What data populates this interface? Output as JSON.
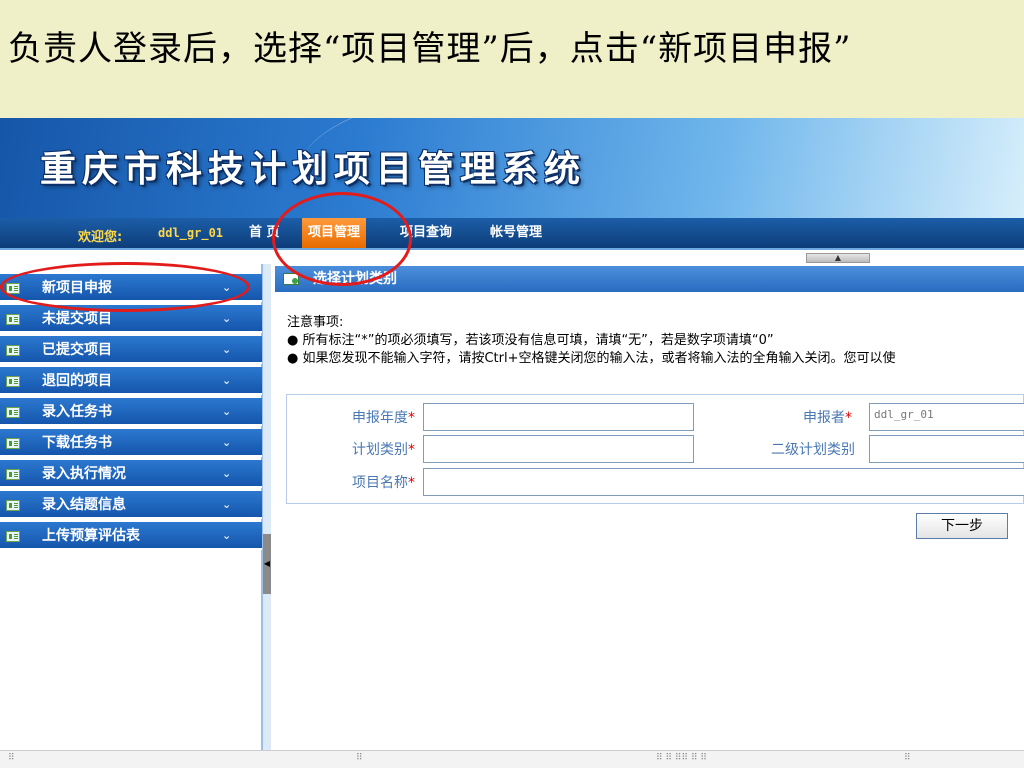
{
  "slide": {
    "title": "负责人登录后，选择“项目管理”后，点击“新项目申报”"
  },
  "app": {
    "banner_title": "重庆市科技计划项目管理系统",
    "welcome_label": "欢迎您:",
    "username": "ddl_gr_01",
    "nav": [
      "首 页",
      "项目管理",
      "项目查询",
      "帐号管理"
    ],
    "active_nav": "项目管理"
  },
  "sidebar": {
    "items": [
      {
        "label": "新项目申报"
      },
      {
        "label": "未提交项目"
      },
      {
        "label": "已提交项目"
      },
      {
        "label": "退回的项目"
      },
      {
        "label": "录入任务书"
      },
      {
        "label": "下载任务书"
      },
      {
        "label": "录入执行情况"
      },
      {
        "label": "录入结题信息"
      },
      {
        "label": "上传预算评估表"
      }
    ],
    "chevron": "⌄"
  },
  "panel": {
    "title": "选择计划类别",
    "notes_heading": "注意事项:",
    "notes": [
      "● 所有标注“*”的项必须填写，若该项没有信息可填，请填“无”，若是数字项请填“0”",
      "● 如果您发现不能输入字符，请按Ctrl+空格键关闭您的输入法，或者将输入法的全角输入关闭。您可以使"
    ]
  },
  "form": {
    "year_label": "申报年度",
    "year_value": "",
    "applicant_label": "申报者",
    "applicant_value": "ddl_gr_01",
    "category_label": "计划类别",
    "category_value": "",
    "subcategory_label": "二级计划类别",
    "subcategory_value": "",
    "name_label": "项目名称",
    "name_value": "",
    "required_mark": "*",
    "next_button": "下一步"
  },
  "colors": {
    "annotation_red": "#e21b1b",
    "nav_active": "#e86b00",
    "sidebar_blue": "#1556ac"
  }
}
